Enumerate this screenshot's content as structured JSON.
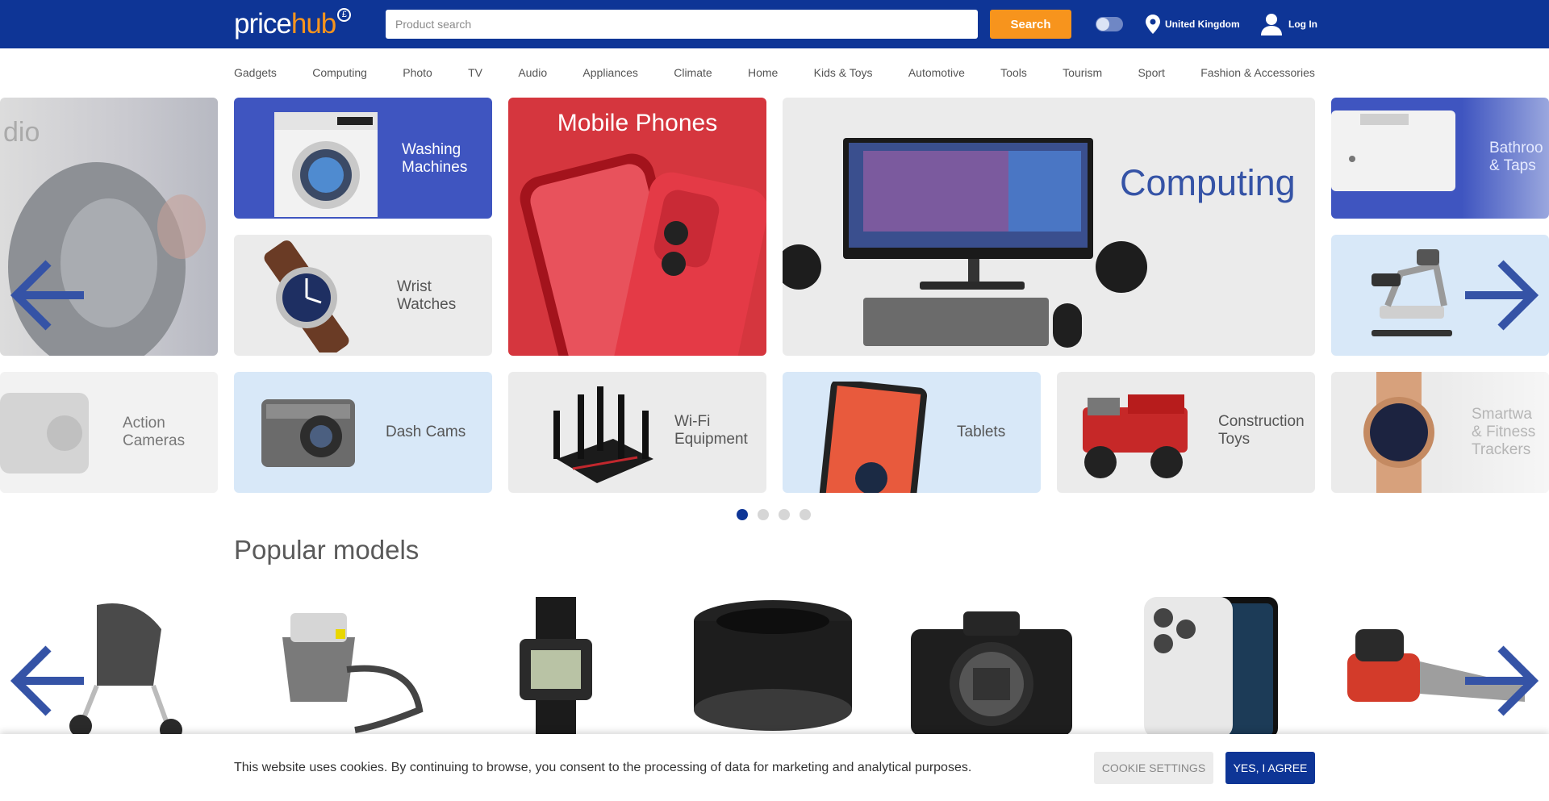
{
  "header": {
    "logo_part1": "price",
    "logo_part2": "hub",
    "logo_currency": "£",
    "search_placeholder": "Product search",
    "search_button": "Search",
    "location": "United Kingdom",
    "login": "Log In",
    "brand_color": "#0e3596",
    "accent_color": "#f7941d"
  },
  "categories": [
    "Gadgets",
    "Computing",
    "Photo",
    "TV",
    "Audio",
    "Appliances",
    "Climate",
    "Home",
    "Kids & Toys",
    "Automotive",
    "Tools",
    "Tourism",
    "Sport",
    "Fashion & Accessories"
  ],
  "tiles": {
    "audio_partial": "dio",
    "washing_machines": "Washing\nMachines",
    "mobile_phones": "Mobile Phones",
    "computing": "Computing",
    "bathroom_partial": "Bathroo\n& Taps",
    "wrist_watches": "Wrist\nWatches",
    "action_cameras": "Action\nCameras",
    "dash_cams": "Dash Cams",
    "wifi_equipment": "Wi-Fi\nEquipment",
    "tablets": "Tablets",
    "construction_toys": "Construction\nToys",
    "smartwatches_partial": "Smartwa\n& Fitness\nTrackers"
  },
  "carousel": {
    "page_count": 4,
    "active_page": 1
  },
  "popular": {
    "title": "Popular models",
    "products": [
      "stroller",
      "wet-vacuum-cleaner",
      "digital-watch",
      "camera-lens",
      "mirrorless-camera",
      "smartphone",
      "chainsaw"
    ]
  },
  "cookie": {
    "text": "This website uses cookies. By continuing to browse, you consent to the processing of data for marketing and analytical purposes.",
    "settings_button": "COOKIE SETTINGS",
    "agree_button": "YES, I AGREE"
  }
}
